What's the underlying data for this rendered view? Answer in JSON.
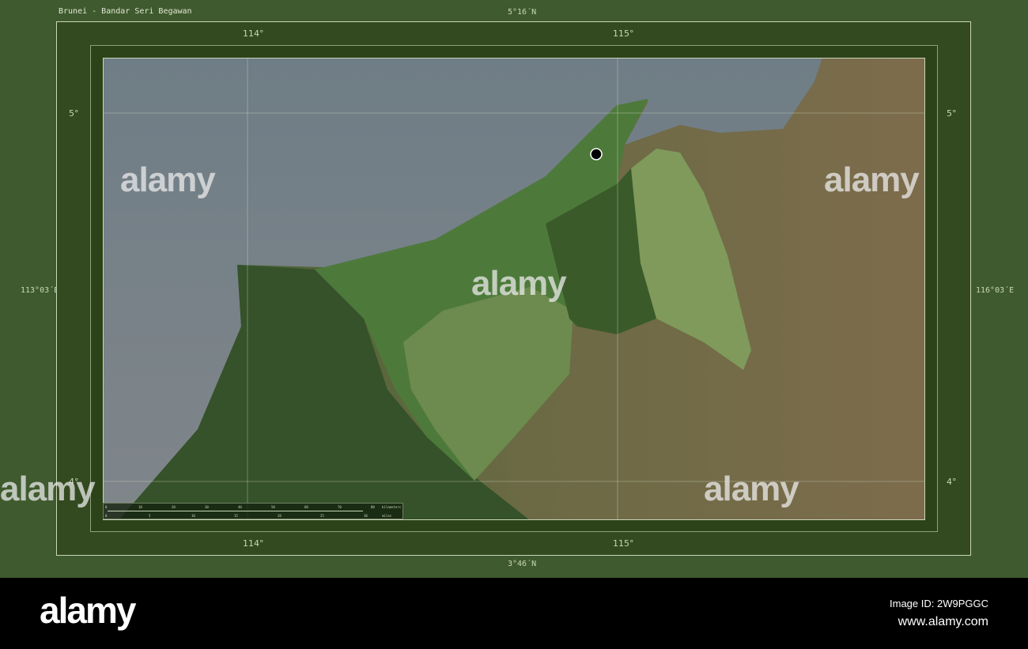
{
  "title": "Brunei - Bandar Seri Begawan",
  "frame": {
    "lat_top": "5°16´N",
    "lat_bottom": "3°46´N",
    "lon_left": "113°03´E",
    "lon_right": "116°03´E"
  },
  "grid": {
    "lon_labels": [
      "114°",
      "115°"
    ],
    "lat_labels": [
      "5°",
      "4°"
    ]
  },
  "scale_bar": {
    "km_ticks": [
      "0",
      "10",
      "20",
      "30",
      "40",
      "50",
      "60",
      "70",
      "80"
    ],
    "km_unit": "kilometers",
    "mile_ticks": [
      "0",
      "5",
      "10",
      "15",
      "20",
      "25",
      "30"
    ],
    "mile_unit": "miles"
  },
  "capital_marker": {
    "name": "Bandar Seri Begawan",
    "color": "#000000"
  },
  "colors": {
    "frame_bg": "#3f5a2e",
    "inner_bg": "#2f4620",
    "sea": "#7d8489",
    "lowland": "#4f7a3a",
    "highland": "#7a6a48"
  },
  "watermark": {
    "text": "alamy"
  },
  "footer": {
    "logo": "alamy",
    "image_id": "Image ID: 2W9PGGC",
    "url": "www.alamy.com"
  }
}
